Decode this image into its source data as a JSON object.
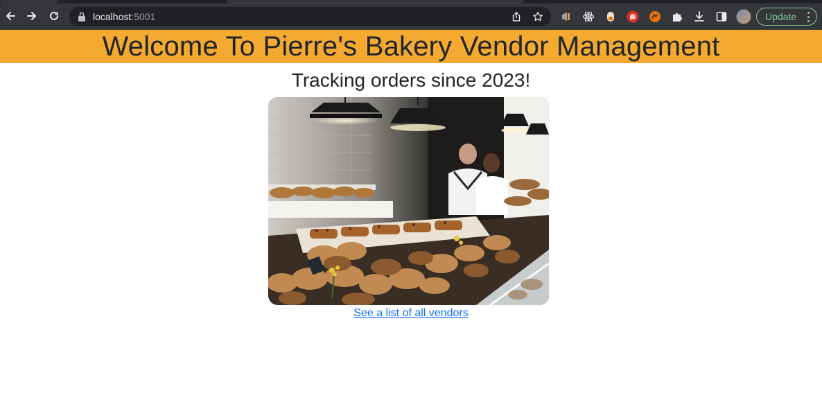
{
  "browser": {
    "url_host": "localhost",
    "url_port": ":5001",
    "update_label": "Update",
    "icons": {
      "back": "arrow-left-icon",
      "forward": "arrow-right-icon",
      "reload": "reload-icon",
      "lock": "lock-icon",
      "share": "share-icon",
      "bookmark": "star-icon",
      "extensions": [
        "extension-icon",
        "react-icon",
        "extension-icon",
        "stop-hand-icon",
        "extension-icon",
        "puzzle-icon",
        "download-icon",
        "sidepanel-icon"
      ],
      "menu": "kebab-menu-icon"
    },
    "colors": {
      "chrome_bg": "#35363a",
      "omnibox_bg": "#202124",
      "update_accent": "#81c995"
    }
  },
  "page": {
    "title": "Welcome To Pierre's Bakery Vendor Management",
    "subtitle": "Tracking orders since 2023!",
    "image_alt": "bakery counter photo",
    "vendors_link": "See a list of all vendors",
    "colors": {
      "banner_bg": "#f4a931",
      "text": "#212529",
      "link": "#0d6efd"
    }
  }
}
